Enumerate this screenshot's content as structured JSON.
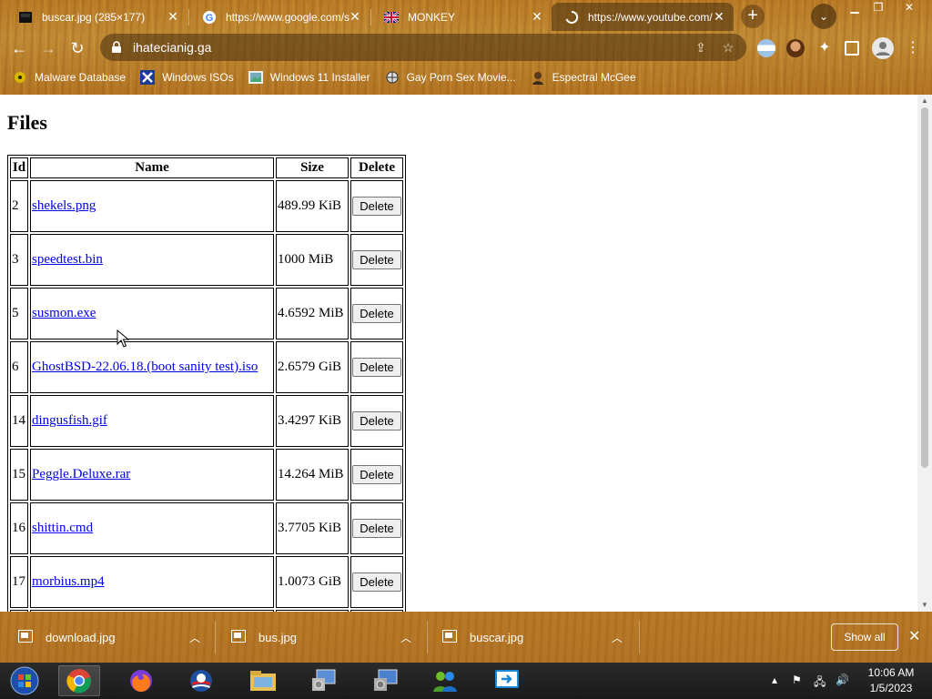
{
  "browser": {
    "tabs": [
      {
        "title": "buscar.jpg (285×177)",
        "icon": "image-file-icon"
      },
      {
        "title": "https://www.google.com/s",
        "icon": "google-icon"
      },
      {
        "title": "MONKEY",
        "icon": "uk-flag-icon"
      },
      {
        "title": "https://www.youtube.com/",
        "icon": "loading-spinner-icon"
      }
    ],
    "new_tab_label": "+",
    "address": "ihatecianig.ga",
    "bookmarks": [
      {
        "label": "Malware Database",
        "icon": "biohazard-icon"
      },
      {
        "label": "Windows ISOs",
        "icon": "x-logo-icon"
      },
      {
        "label": "Windows 11 Installer",
        "icon": "image-icon"
      },
      {
        "label": "Gay Porn Sex Movie...",
        "icon": "globe-icon"
      },
      {
        "label": "Espectral McGee",
        "icon": "avatar-icon"
      }
    ]
  },
  "page": {
    "heading": "Files",
    "table": {
      "headers": [
        "Id",
        "Name",
        "Size",
        "Delete"
      ],
      "rows": [
        {
          "id": "2",
          "name": "shekels.png",
          "size": "489.99 KiB",
          "action": "Delete"
        },
        {
          "id": "3",
          "name": "speedtest.bin",
          "size": "1000 MiB",
          "action": "Delete"
        },
        {
          "id": "5",
          "name": "susmon.exe",
          "size": "4.6592 MiB",
          "action": "Delete"
        },
        {
          "id": "6",
          "name": "GhostBSD-22.06.18.(boot sanity test).iso",
          "size": "2.6579 GiB",
          "action": "Delete"
        },
        {
          "id": "14",
          "name": "dingusfish.gif",
          "size": "3.4297 KiB",
          "action": "Delete"
        },
        {
          "id": "15",
          "name": "Peggle.Deluxe.rar",
          "size": "14.264 MiB",
          "action": "Delete"
        },
        {
          "id": "16",
          "name": "shittin.cmd",
          "size": "3.7705 KiB",
          "action": "Delete"
        },
        {
          "id": "17",
          "name": "morbius.mp4",
          "size": "1.0073 GiB",
          "action": "Delete"
        },
        {
          "id": "",
          "name": "",
          "size": "",
          "action": ""
        }
      ]
    }
  },
  "downloads": {
    "items": [
      {
        "name": "download.jpg"
      },
      {
        "name": "bus.jpg"
      },
      {
        "name": "buscar.jpg"
      }
    ],
    "show_all": "Show all"
  },
  "taskbar": {
    "apps": [
      "start-orb-icon",
      "chrome-icon",
      "firefox-icon",
      "obama-logo-icon",
      "file-explorer-icon",
      "installer-icon",
      "network-setup-icon",
      "users-icon",
      "remote-desktop-icon"
    ],
    "time": "10:06 AM",
    "date": "1/5/2023"
  },
  "colors": {
    "wood": "#b97a26",
    "link": "#0000ee",
    "taskbar": "#1f1f1f"
  }
}
